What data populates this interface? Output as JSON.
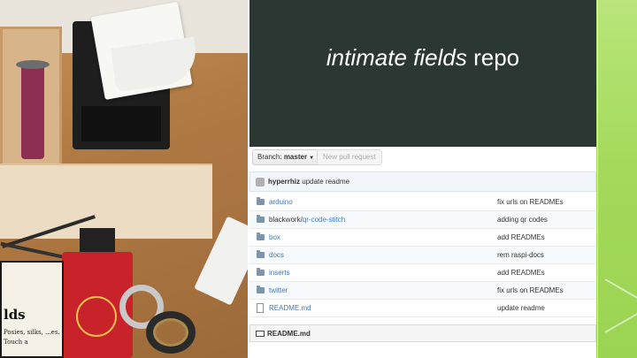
{
  "slide": {
    "title_italic": "intimate fields",
    "title_rest": "repo"
  },
  "photo": {
    "card_title": "lds",
    "card_text": "Posies, silks, ...es. Touch a"
  },
  "repo": {
    "branch_label": "Branch:",
    "branch_name": "master",
    "new_pull_request": "New pull request",
    "latest_commit": {
      "author": "hyperrhiz",
      "message": "update readme"
    },
    "files": [
      {
        "type": "dir",
        "name": "arduino",
        "message": "fix urls on READMEs"
      },
      {
        "type": "dir",
        "name_prefix": "blackwork/",
        "name": "qr-code-stitch",
        "message": "adding qr codes"
      },
      {
        "type": "dir",
        "name": "box",
        "message": "add READMEs"
      },
      {
        "type": "dir",
        "name": "docs",
        "message": "rem raspi-docs"
      },
      {
        "type": "dir",
        "name": "inserts",
        "message": "add READMEs"
      },
      {
        "type": "dir",
        "name": "twitter",
        "message": "fix urls on READMEs"
      },
      {
        "type": "file",
        "name": "README.md",
        "message": "update readme"
      }
    ],
    "readme_header": "README.md"
  },
  "icons": {
    "folder": "folder-icon",
    "file": "file-icon",
    "book": "book-icon",
    "avatar": "avatar"
  },
  "colors": {
    "header_bg": "#2b3733",
    "accent_green": "#a4da5c",
    "link_blue": "#4078c0"
  }
}
